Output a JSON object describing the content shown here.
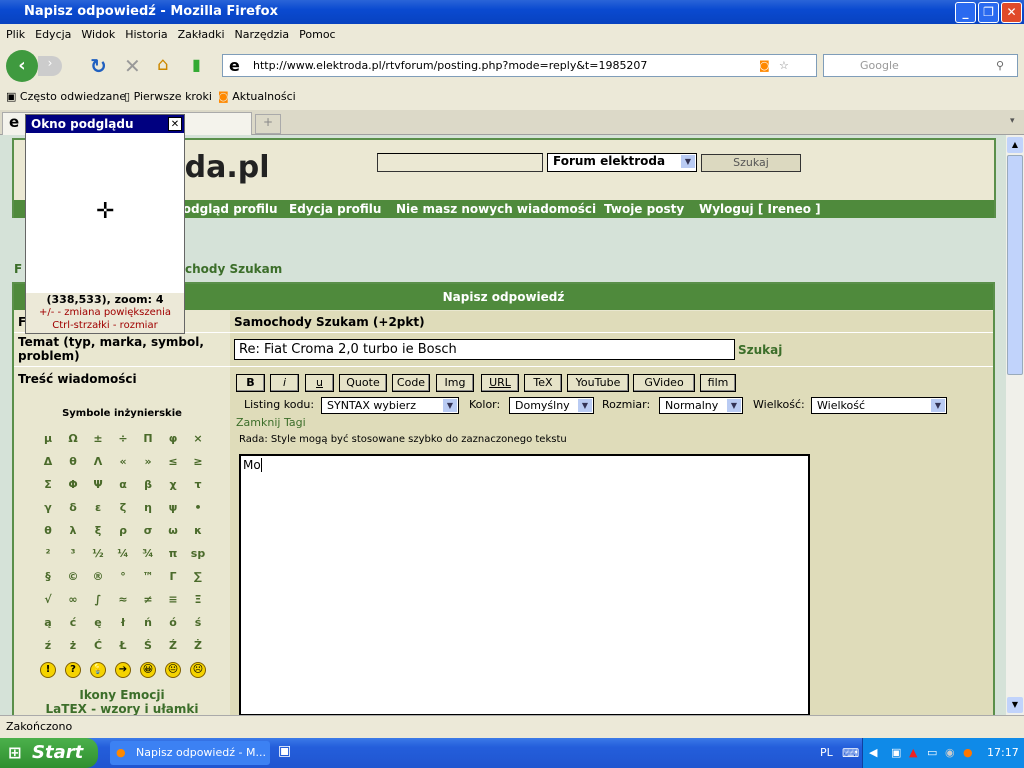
{
  "window": {
    "title": "Napisz odpowiedź - Mozilla Firefox"
  },
  "menu": [
    "Plik",
    "Edycja",
    "Widok",
    "Historia",
    "Zakładki",
    "Narzędzia",
    "Pomoc"
  ],
  "navbar": {
    "url": "http://www.elektroda.pl/rtvforum/posting.php?mode=reply&t=1985207",
    "search_placeholder": "Google"
  },
  "bookmarks": [
    "Często odwiedzane",
    "Pierwsze kroki",
    "Aktualności"
  ],
  "popup": {
    "title": "Okno podglądu",
    "coords": "(338,533), zoom: 4",
    "hint1": "+/- - zmiana powiększenia",
    "hint2": "Ctrl-strzałki - rozmiar"
  },
  "site": {
    "logo": "oda.pl",
    "forum_select": "Forum elektroda",
    "search_button": "Szukaj",
    "nav": [
      "Podgląd profilu",
      "Edycja profilu",
      "Nie masz nowych wiadomości",
      "Twoje posty",
      "Wyloguj [ Ireneo ]"
    ],
    "breadcrumb": [
      "F",
      "chody Szukam"
    ]
  },
  "form": {
    "header": "Napisz odpowiedź",
    "forum_label": "F",
    "forum_value": "Samochody Szukam (+2pkt)",
    "subject_label": "Temat (typ, marka, symbol, problem)",
    "subject_value": "Re: Fiat Croma 2,0 turbo ie Bosch",
    "subject_search": "Szukaj",
    "body_label": "Treść wiadomości",
    "buttons": [
      "B",
      "i",
      "u",
      "Quote",
      "Code",
      "Img",
      "URL",
      "TeX",
      "YouTube",
      "GVideo",
      "film"
    ],
    "listing_label": "Listing kodu:",
    "listing_value": "SYNTAX wybierz",
    "color_label": "Kolor:",
    "color_value": "Domyślny",
    "size_label": "Rozmiar:",
    "size_value": "Normalny",
    "magnitude_label": "Wielkość:",
    "magnitude_value": "Wielkość",
    "close_tags": "Zamknij Tagi",
    "hint": "Rada: Style mogą być stosowane szybko do zaznaczonego tekstu",
    "message": "Mo",
    "symbols_title": "Symbole inżynierskie",
    "symbols": [
      "μ",
      "Ω",
      "±",
      "÷",
      "Π",
      "φ",
      "×",
      "Δ",
      "θ",
      "Λ",
      "«",
      "»",
      "≤",
      "≥",
      "Σ",
      "Φ",
      "Ψ",
      "α",
      "β",
      "χ",
      "τ",
      "γ",
      "δ",
      "ε",
      "ζ",
      "η",
      "ψ",
      "•",
      "θ",
      "λ",
      "ξ",
      "ρ",
      "σ",
      "ω",
      "κ",
      "²",
      "³",
      "½",
      "¼",
      "¾",
      "π",
      "sp",
      "§",
      "©",
      "®",
      "°",
      "™",
      "Γ",
      "∑",
      "√",
      "∞",
      "∫",
      "≈",
      "≠",
      "≡",
      "Ξ",
      "ą",
      "ć",
      "ę",
      "ł",
      "ń",
      "ó",
      "ś",
      "ź",
      "ż",
      "Ć",
      "Ł",
      "Ś",
      "Ź",
      "Ż"
    ],
    "emoticons": [
      "!",
      "?",
      "💡",
      "➔",
      "😀",
      "😐",
      "☹"
    ],
    "emoticons_link": "Ikony Emocji",
    "latex_link": "LaTEX - wzory i ułamki"
  },
  "status": "Zakończono",
  "taskbar": {
    "start": "Start",
    "task": "Napisz odpowiedź - M...",
    "lang": "PL",
    "clock": "17:17"
  }
}
